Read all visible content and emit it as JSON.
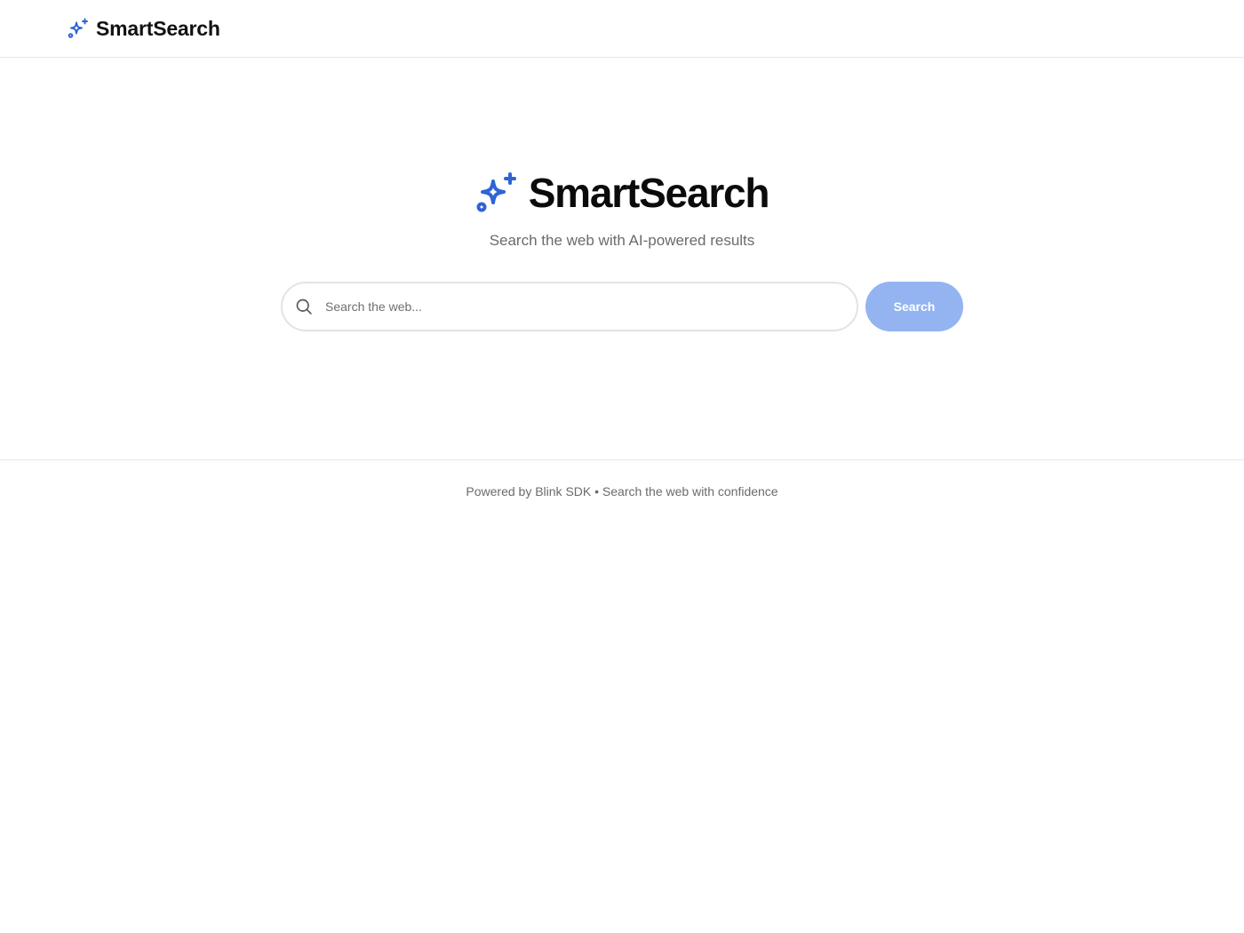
{
  "header": {
    "title": "SmartSearch",
    "logo_icon": "sparkles-icon"
  },
  "hero": {
    "title": "SmartSearch",
    "logo_icon": "sparkles-icon",
    "tagline": "Search the web with AI-powered results"
  },
  "search": {
    "placeholder": "Search the web...",
    "value": "",
    "icon": "search-icon",
    "button_label": "Search"
  },
  "footer": {
    "text": "Powered by Blink SDK • Search the web with confidence"
  },
  "colors": {
    "accent": "#2f63d6",
    "button_bg": "#93b4f1",
    "border": "#e5e7eb",
    "muted_text": "#6b6b6b"
  }
}
